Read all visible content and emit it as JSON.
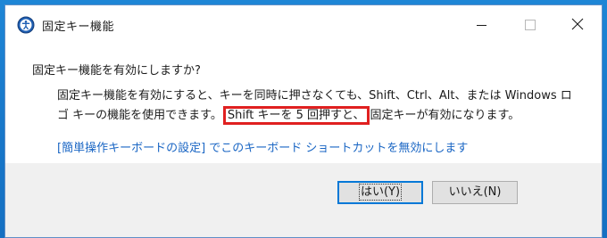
{
  "window": {
    "title": "固定キー機能"
  },
  "titlebar": {
    "minimize_icon": "minimize-icon",
    "maximize_icon": "maximize-icon",
    "close_icon": "close-icon"
  },
  "dialog": {
    "heading": "固定キー機能を有効にしますか?",
    "body_line1": "固定キー機能を有効にすると、キーを同時に押さなくても、Shift、Ctrl、Alt、または Windows ロ",
    "body_line2_pre": "ゴ キーの機能を使用できます。",
    "body_line2_highlight": "Shift キーを 5 回押すと、",
    "body_line2_post": "固定キーが有効になります。",
    "link_text": "[簡単操作キーボードの設定] でこのキーボード ショートカットを無効にします"
  },
  "buttons": {
    "yes_label": "はい(Y)",
    "no_label": "いいえ(N)"
  },
  "colors": {
    "highlight_border": "#e02020",
    "link": "#1a66c4",
    "focus": "#0078d7",
    "desktop": "#1877c9"
  }
}
